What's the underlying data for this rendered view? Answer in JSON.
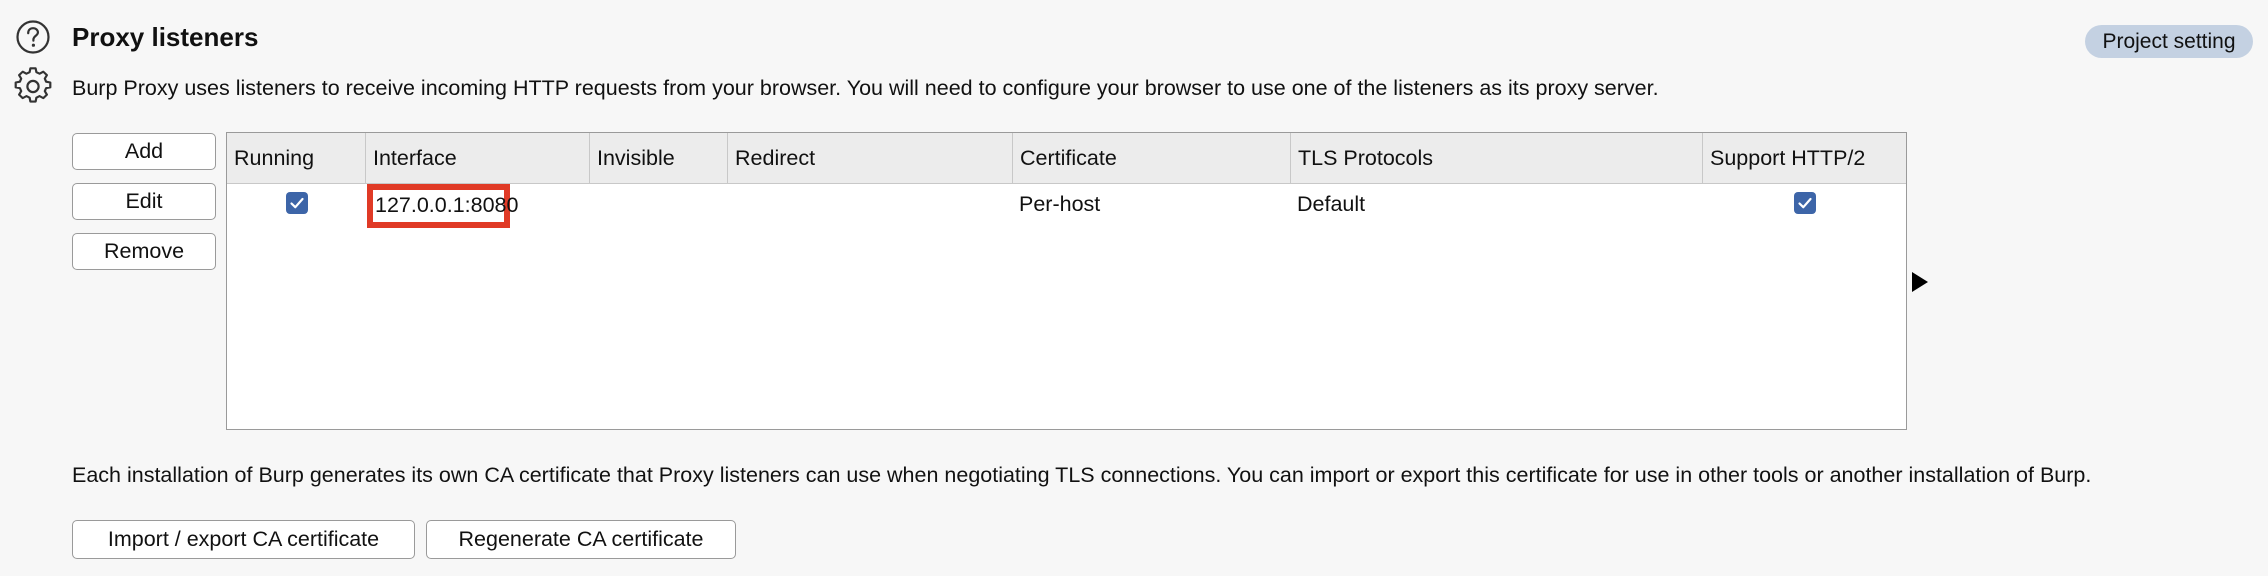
{
  "header": {
    "title": "Proxy listeners",
    "description": "Burp Proxy uses listeners to receive incoming HTTP requests from your browser. You will need to configure your browser to use one of the listeners as its proxy server.",
    "badge": "Project setting",
    "icons": [
      "help-icon",
      "gear-icon"
    ]
  },
  "side_buttons": {
    "add": "Add",
    "edit": "Edit",
    "remove": "Remove"
  },
  "table": {
    "columns": [
      "Running",
      "Interface",
      "Invisible",
      "Redirect",
      "Certificate",
      "TLS Protocols",
      "Support HTTP/2"
    ],
    "rows": [
      {
        "running": true,
        "interface": "127.0.0.1:8080",
        "invisible": "",
        "redirect": "",
        "certificate": "Per-host",
        "tls_protocols": "Default",
        "support_http2": true
      }
    ]
  },
  "ca": {
    "description": "Each installation of Burp generates its own CA certificate that Proxy listeners can use when negotiating TLS connections. You can import or export this certificate for use in other tools or another installation of Burp.",
    "import_export_label": "Import / export CA certificate",
    "regenerate_label": "Regenerate CA certificate"
  },
  "colors": {
    "accent": "#3d65a8",
    "highlight": "#e03a26",
    "badge_bg": "#c4d1e2"
  }
}
